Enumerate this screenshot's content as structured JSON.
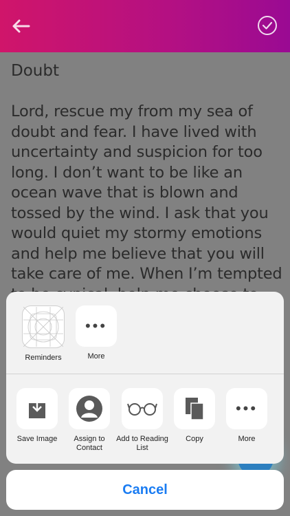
{
  "header": {
    "back_icon": "arrow-left-icon",
    "confirm_icon": "check-circle-icon",
    "gradient": [
      "#d0156a",
      "#9a0a93"
    ]
  },
  "prayer": {
    "title": "Doubt",
    "text": "Lord, rescue my from my sea of doubt and fear. I have lived with uncertainty and suspicion for too long. I don’t want to be like an ocean wave that is blown and tossed by the wind. I ask that you would quiet my stormy emotions and help me believe that you will take care of me. When I’m tempted to be cynical, help me choose to step away from fear and"
  },
  "share_sheet": {
    "apps": [
      {
        "label": "Reminders",
        "icon": "reminders-app-icon"
      },
      {
        "label": "More",
        "icon": "more-dots-icon"
      }
    ],
    "actions": [
      {
        "label": "Save Image",
        "icon": "save-image-icon"
      },
      {
        "label": "Assign to Contact",
        "icon": "contact-silhouette-icon"
      },
      {
        "label": "Add to Reading List",
        "icon": "glasses-icon"
      },
      {
        "label": "Copy",
        "icon": "copy-icon"
      },
      {
        "label": "More",
        "icon": "more-dots-icon"
      }
    ],
    "cancel_label": "Cancel"
  },
  "colors": {
    "cancel_text": "#1a7cf2",
    "fab": "#2d7fbf"
  }
}
